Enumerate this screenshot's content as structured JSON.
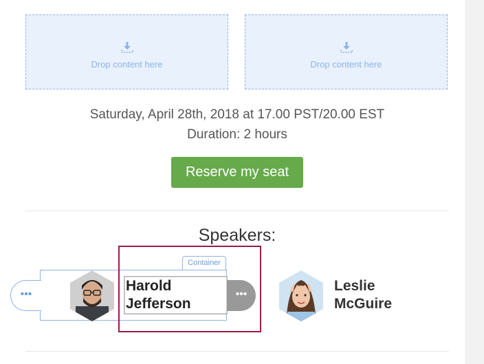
{
  "dropzones": [
    {
      "label": "Drop content here",
      "icon": "download-icon"
    },
    {
      "label": "Drop content here",
      "icon": "download-icon"
    }
  ],
  "event": {
    "date": "Saturday, April 28th, 2018 at 17.00 PST/20.00 EST",
    "duration": "Duration: 2 hours"
  },
  "cta": {
    "label": "Reserve my seat",
    "color": "#67aa4b"
  },
  "speakers": {
    "title": "Speakers:",
    "container_tag": "Container",
    "more_glyph": "•••",
    "items": [
      {
        "first": "Harold",
        "last": "Jefferson",
        "avatar": "man-with-glasses-avatar"
      },
      {
        "first": "Leslie",
        "last": "McGuire",
        "avatar": "woman-peace-sign-avatar"
      }
    ]
  },
  "colors": {
    "accent": "#8fb3e6",
    "selection_outline": "#9b1b4b",
    "dropzone_bg": "#e9f1fd"
  }
}
